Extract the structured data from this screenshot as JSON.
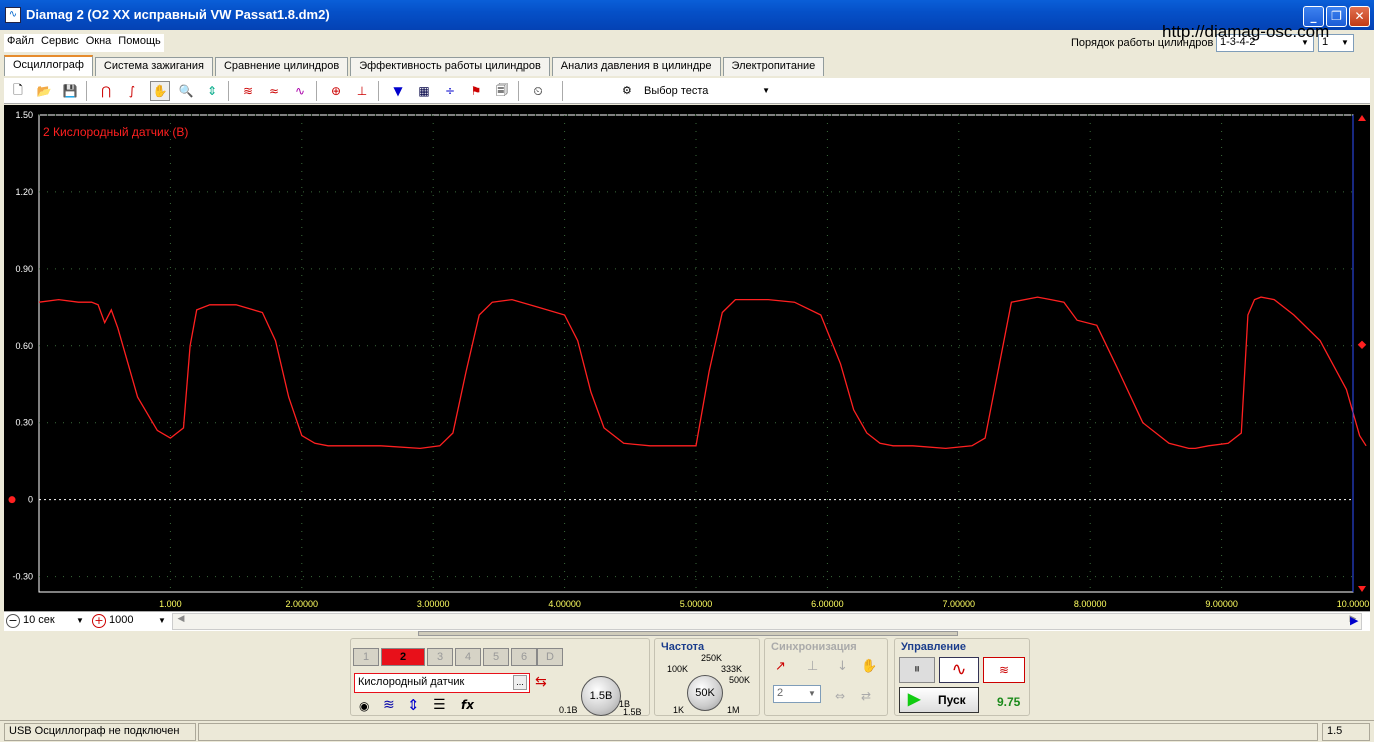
{
  "window": {
    "title": "Diamag 2 (O2 XX исправный VW Passat1.8.dm2)"
  },
  "menu": [
    "Файл",
    "Сервис",
    "Окна",
    "Помощь"
  ],
  "url_overlay": "http://diamag-osc.com",
  "cylinder_order": {
    "label": "Порядок работы цилиндров",
    "value": "1-3-4-2",
    "second_value": "1"
  },
  "tabs": [
    "Осциллограф",
    "Система зажигания",
    "Сравнение цилиндров",
    "Эффективность работы цилиндров",
    "Анализ давления в цилиндре",
    "Электропитание"
  ],
  "active_tab": 0,
  "toolbar": {
    "test_select": "Выбор теста"
  },
  "chart_data": {
    "type": "line",
    "title": "2 Кислородный датчик (В)",
    "ylim": [
      -0.45,
      1.5
    ],
    "yticks": [
      "1.50",
      "1.20",
      "0.90",
      "0.60",
      "0.30",
      "0",
      "-0.30"
    ],
    "xlim": [
      0,
      10
    ],
    "xticks": [
      "1.000",
      "2.00000",
      "3.00000",
      "4.00000",
      "5.00000",
      "6.00000",
      "7.00000",
      "8.00000",
      "9.00000",
      "10.0000"
    ],
    "grid": true,
    "series": [
      {
        "color": "#ff2020",
        "x": [
          0.0,
          0.15,
          0.3,
          0.4,
          0.45,
          0.5,
          0.55,
          0.6,
          0.65,
          0.75,
          0.9,
          1.0,
          1.1,
          1.15,
          1.2,
          1.3,
          1.5,
          1.7,
          1.8,
          1.9,
          2.0,
          2.1,
          2.2,
          2.35,
          2.6,
          2.9,
          3.05,
          3.15,
          3.25,
          3.35,
          3.45,
          3.6,
          3.8,
          4.0,
          4.1,
          4.2,
          4.3,
          4.45,
          4.65,
          4.85,
          5.0,
          5.1,
          5.2,
          5.3,
          5.4,
          5.55,
          5.75,
          5.95,
          6.1,
          6.2,
          6.3,
          6.4,
          6.5,
          6.65,
          6.9,
          7.1,
          7.2,
          7.4,
          7.6,
          7.7,
          7.8,
          7.9,
          8.05,
          8.2,
          8.4,
          8.6,
          8.75,
          8.8,
          8.9,
          9.05,
          9.15,
          9.2,
          9.25,
          9.3,
          9.4,
          9.55,
          9.75,
          9.95,
          10.05,
          10.1
        ],
        "y": [
          0.77,
          0.78,
          0.77,
          0.77,
          0.76,
          0.69,
          0.74,
          0.67,
          0.58,
          0.4,
          0.27,
          0.24,
          0.28,
          0.6,
          0.74,
          0.76,
          0.76,
          0.73,
          0.62,
          0.4,
          0.25,
          0.22,
          0.21,
          0.21,
          0.21,
          0.2,
          0.21,
          0.26,
          0.5,
          0.72,
          0.77,
          0.78,
          0.75,
          0.72,
          0.62,
          0.42,
          0.28,
          0.22,
          0.21,
          0.21,
          0.21,
          0.5,
          0.73,
          0.78,
          0.78,
          0.78,
          0.77,
          0.72,
          0.53,
          0.35,
          0.26,
          0.22,
          0.21,
          0.21,
          0.2,
          0.21,
          0.24,
          0.77,
          0.79,
          0.78,
          0.77,
          0.7,
          0.68,
          0.52,
          0.3,
          0.22,
          0.2,
          0.2,
          0.21,
          0.22,
          0.26,
          0.72,
          0.78,
          0.79,
          0.78,
          0.72,
          0.62,
          0.43,
          0.25,
          0.21
        ]
      }
    ]
  },
  "controls": {
    "time_base": "10 сек",
    "samples": "1000"
  },
  "channels": [
    "1",
    "2",
    "3",
    "4",
    "5",
    "6",
    "D"
  ],
  "active_channel": "2",
  "sensor": {
    "name": "Кислородный датчик",
    "more": "..."
  },
  "range_knob": {
    "value": "1.5В",
    "min": "0.1В",
    "max": "1.5В",
    "marker": "1В"
  },
  "frequency": {
    "title": "Частота",
    "value": "50K",
    "labels": [
      "100K",
      "250K",
      "333K",
      "500K",
      "1K",
      "1M"
    ]
  },
  "sync": {
    "title": "Синхронизация",
    "channel": "2"
  },
  "control": {
    "title": "Управление",
    "start": "Пуск",
    "value": "9.75"
  },
  "status": {
    "left": "USB Осциллограф не подключен",
    "right": "1.5"
  }
}
